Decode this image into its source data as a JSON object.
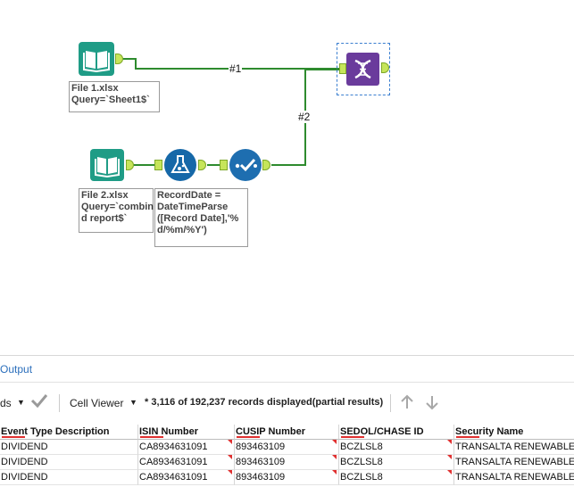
{
  "canvas": {
    "connections": [
      {
        "label": "#1"
      },
      {
        "label": "#2"
      }
    ],
    "tools": {
      "input1": {
        "annotation_line1": "File 1.xlsx",
        "annotation_line2": "Query=`Sheet1$`"
      },
      "input2": {
        "annotation_line1": "File 2.xlsx",
        "annotation_line2": "Query=`combin",
        "annotation_line3": "d report$`"
      },
      "formula": {
        "annotation": "RecordDate =\nDateTimeParse\n([Record Date],'%\nd/%m/%Y')"
      }
    },
    "colors": {
      "input_tool": "#1f9c86",
      "formula_tool": "#1668a8",
      "select_tool": "#1e6eb0",
      "join_tool": "#6a3b9c",
      "connection": "#2e8b2e",
      "anchor": "#c6e55a"
    }
  },
  "results": {
    "title": "Output",
    "toolbar": {
      "fields_label": "ds",
      "cell_viewer_label": "Cell Viewer",
      "records_text": "* 3,116 of 192,237 records displayed(partial results)"
    },
    "columns": [
      "Event Type Description",
      "ISIN Number",
      "CUSIP Number",
      "SEDOL/CHASE ID",
      "Security Name"
    ],
    "rows": [
      [
        "DIVIDEND",
        "CA8934631091",
        "893463109",
        "BCZLSL8",
        "TRANSALTA RENEWABLES"
      ],
      [
        "DIVIDEND",
        "CA8934631091",
        "893463109",
        "BCZLSL8",
        "TRANSALTA RENEWABLES"
      ],
      [
        "DIVIDEND",
        "CA8934631091",
        "893463109",
        "BCZLSL8",
        "TRANSALTA RENEWABLES"
      ]
    ]
  }
}
